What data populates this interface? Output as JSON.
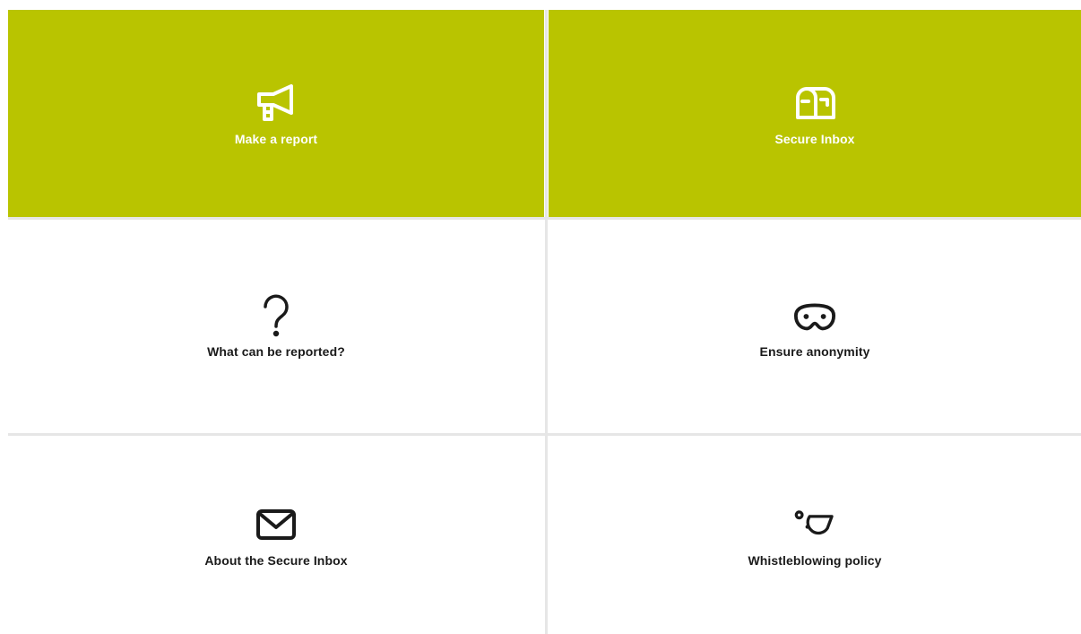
{
  "colors": {
    "accent": "#b9c400",
    "divider": "#e6e6e6",
    "tile_text_dark": "#1a1a1a",
    "tile_text_light": "#ffffff"
  },
  "tiles": [
    {
      "label": "Make a report",
      "icon": "megaphone-icon"
    },
    {
      "label": "Secure Inbox",
      "icon": "mailbox-icon"
    },
    {
      "label": "What can be reported?",
      "icon": "question-mark-icon"
    },
    {
      "label": "Ensure anonymity",
      "icon": "mask-icon"
    },
    {
      "label": "About the Secure Inbox",
      "icon": "envelope-icon"
    },
    {
      "label": "Whistleblowing policy",
      "icon": "whistle-icon"
    }
  ]
}
